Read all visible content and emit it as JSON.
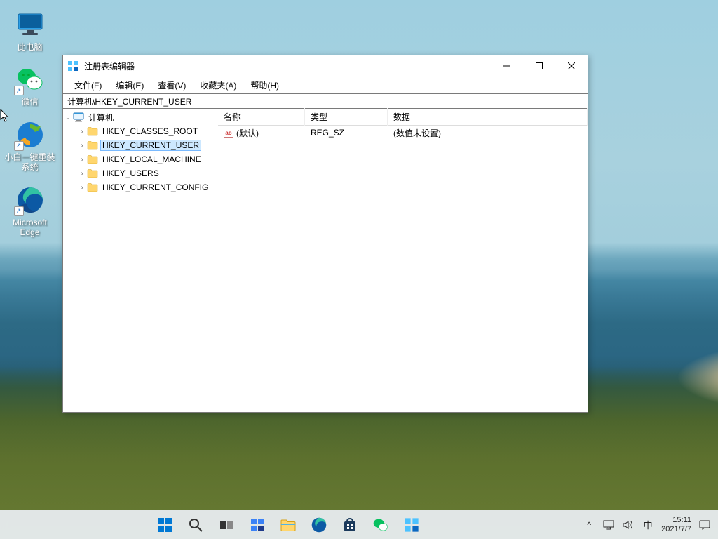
{
  "desktop": {
    "icons": [
      {
        "name": "this-pc",
        "label": "此电脑",
        "icon": "pc"
      },
      {
        "name": "wechat",
        "label": "微信",
        "icon": "wechat",
        "shortcut": true
      },
      {
        "name": "xiaobai",
        "label": "小白一键重装系统",
        "icon": "xiaobai",
        "shortcut": true
      },
      {
        "name": "edge",
        "label": "Microsoft Edge",
        "icon": "edge",
        "shortcut": true
      }
    ]
  },
  "window": {
    "title": "注册表编辑器",
    "menu": [
      "文件(F)",
      "编辑(E)",
      "查看(V)",
      "收藏夹(A)",
      "帮助(H)"
    ],
    "address": "计算机\\HKEY_CURRENT_USER",
    "tree": {
      "root": "计算机",
      "keys": [
        "HKEY_CLASSES_ROOT",
        "HKEY_CURRENT_USER",
        "HKEY_LOCAL_MACHINE",
        "HKEY_USERS",
        "HKEY_CURRENT_CONFIG"
      ],
      "selected_index": 1
    },
    "list": {
      "columns": {
        "name": "名称",
        "type": "类型",
        "data": "数据"
      },
      "rows": [
        {
          "name": "(默认)",
          "type": "REG_SZ",
          "data": "(数值未设置)"
        }
      ]
    }
  },
  "taskbar": {
    "buttons": [
      {
        "name": "start",
        "icon": "start"
      },
      {
        "name": "search",
        "icon": "search"
      },
      {
        "name": "taskview",
        "icon": "taskview"
      },
      {
        "name": "widgets",
        "icon": "widgets"
      },
      {
        "name": "explorer",
        "icon": "explorer"
      },
      {
        "name": "edge",
        "icon": "edge"
      },
      {
        "name": "store",
        "icon": "store"
      },
      {
        "name": "wechat",
        "icon": "wechat"
      },
      {
        "name": "regedit",
        "icon": "regedit"
      }
    ],
    "tray": {
      "chevron": "^",
      "ime": "中",
      "time": "15:11",
      "date": "2021/7/7"
    }
  }
}
